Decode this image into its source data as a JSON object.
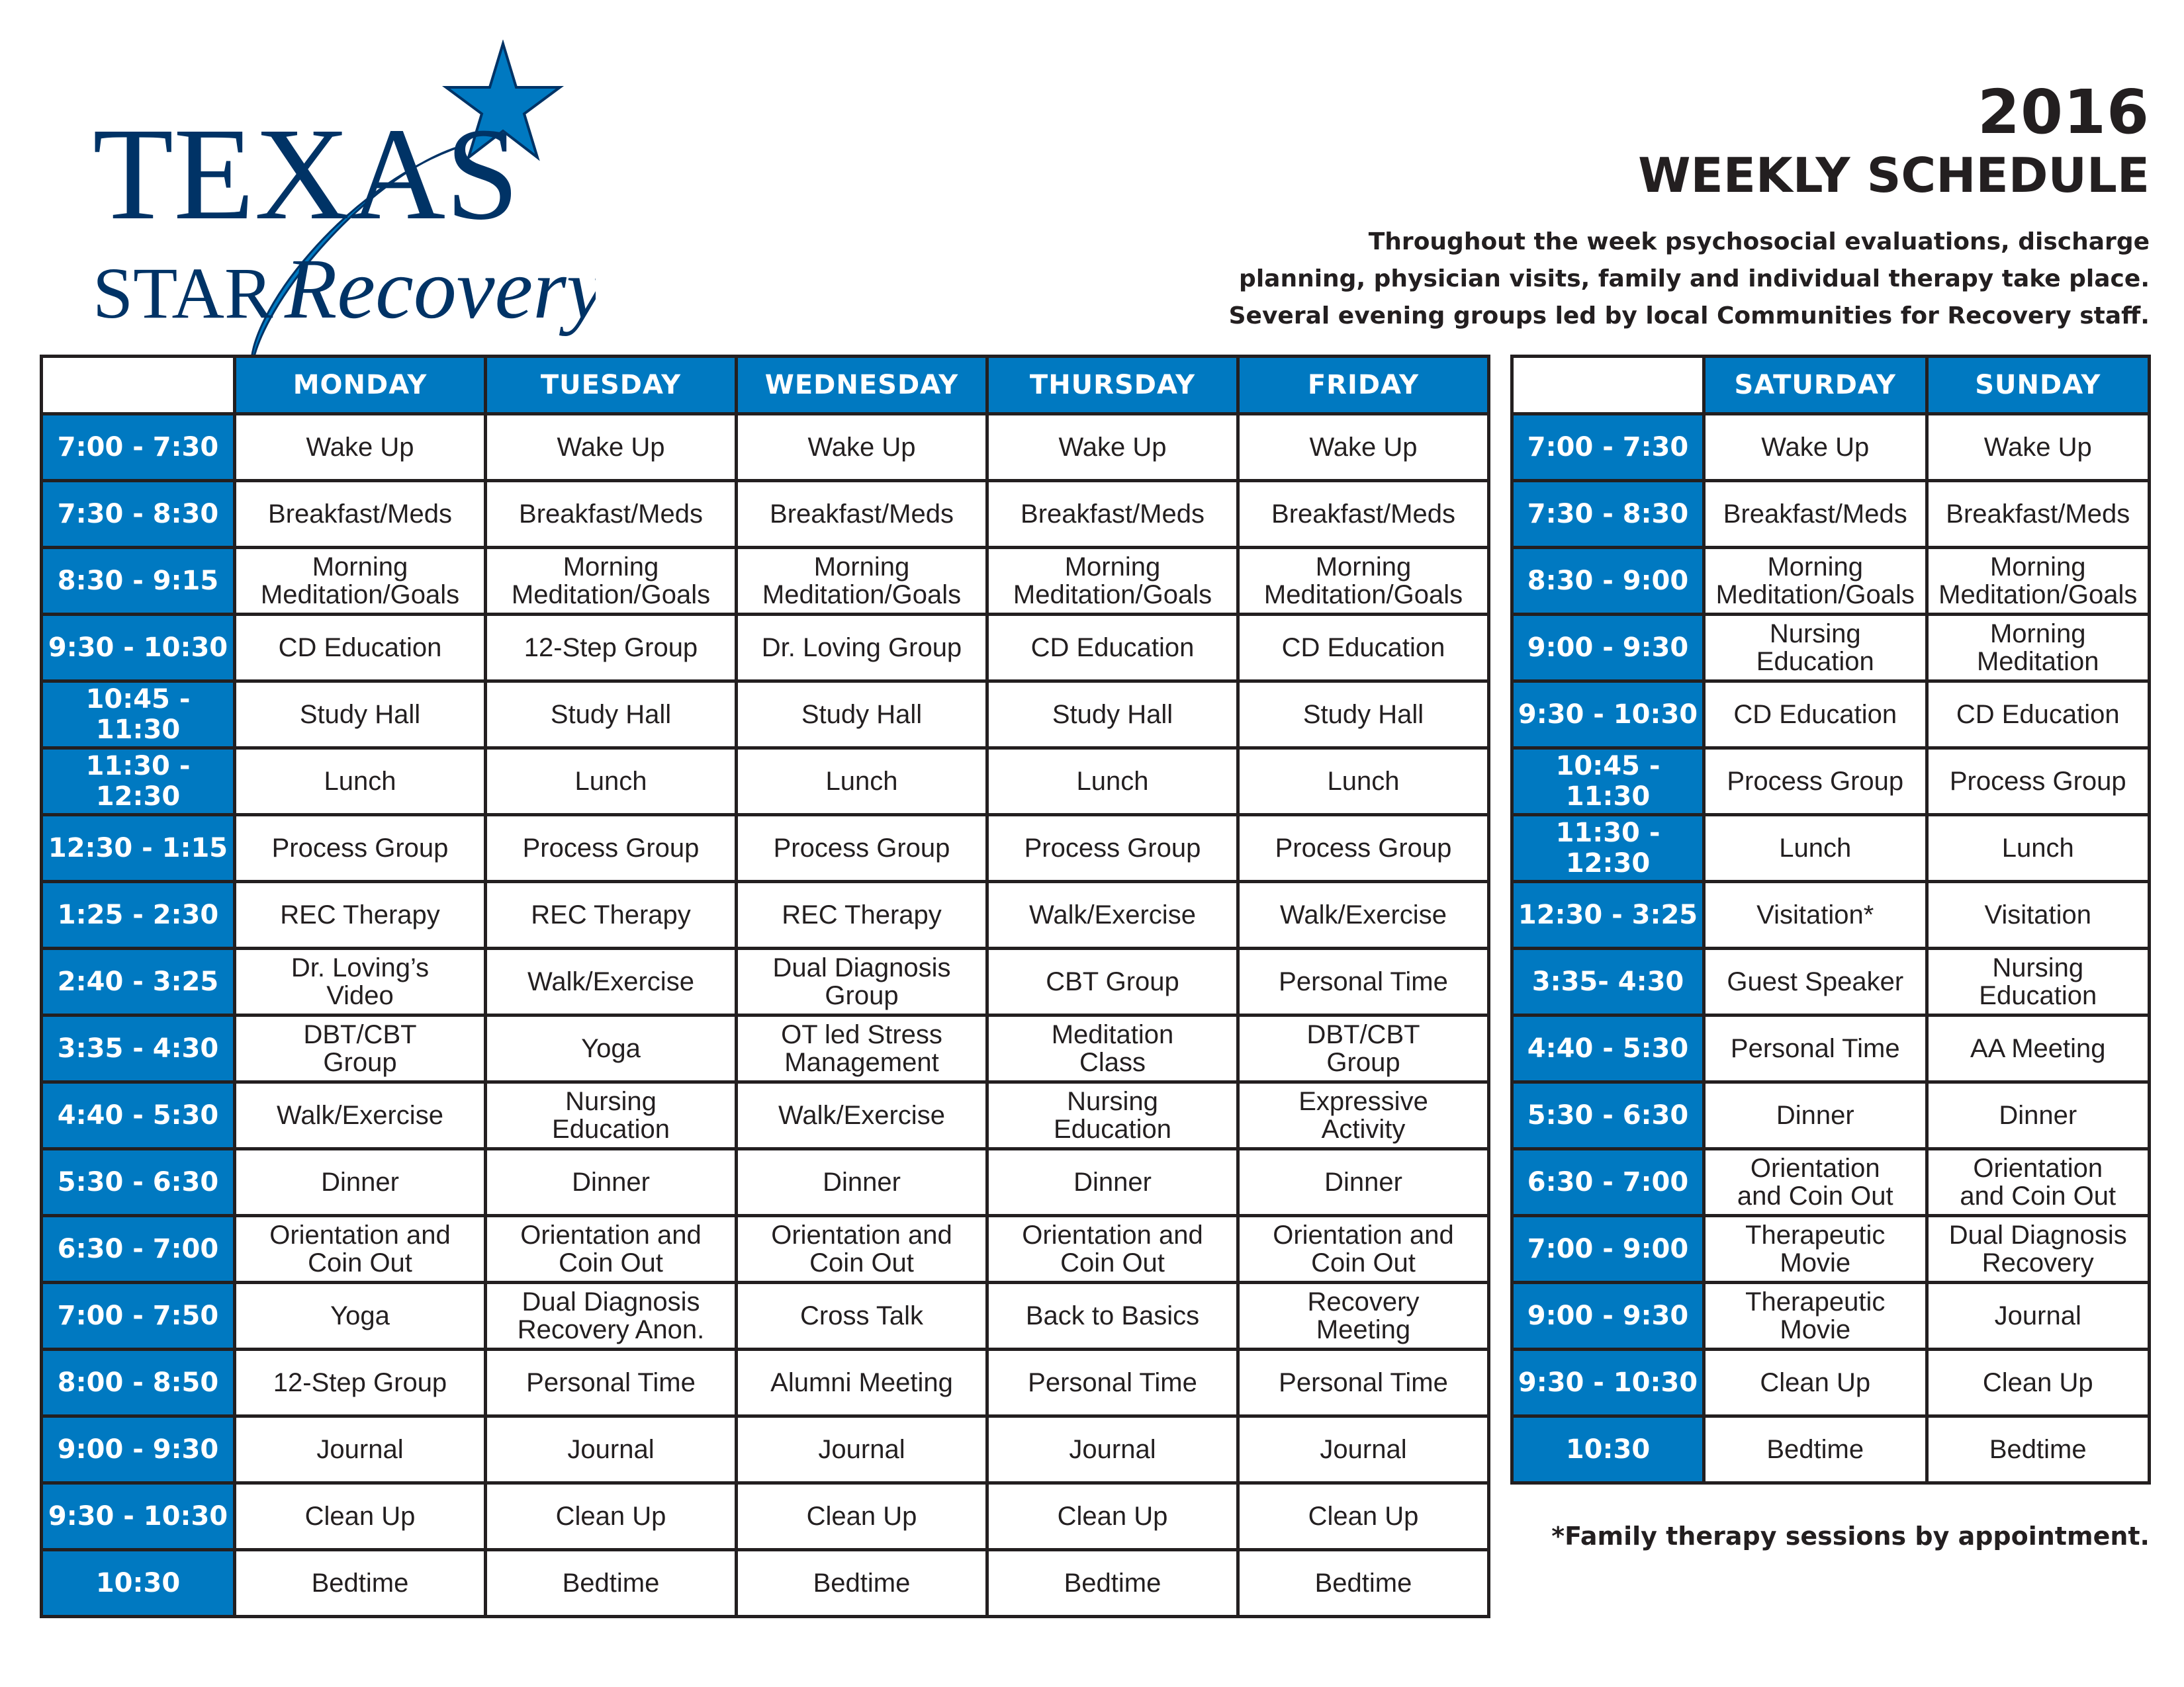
{
  "brand": {
    "logo_line1": "TEXAS",
    "logo_line2_a": "STAR",
    "logo_line2_b": "Recovery",
    "navy": "#003366",
    "accent_blue": "#0079c1"
  },
  "header": {
    "year": "2016",
    "title": "WEEKLY SCHEDULE",
    "description_lines": [
      "Throughout the week psychosocial evaluations, discharge",
      "planning, physician visits, family and individual therapy take place.",
      "Several evening groups led by local Communities for Recovery staff."
    ]
  },
  "weekday_table": {
    "days": [
      "MONDAY",
      "TUESDAY",
      "WEDNESDAY",
      "THURSDAY",
      "FRIDAY"
    ],
    "rows": [
      {
        "time": "7:00 - 7:30",
        "cells": [
          "Wake Up",
          "Wake Up",
          "Wake Up",
          "Wake Up",
          "Wake Up"
        ]
      },
      {
        "time": "7:30 - 8:30",
        "cells": [
          "Breakfast/Meds",
          "Breakfast/Meds",
          "Breakfast/Meds",
          "Breakfast/Meds",
          "Breakfast/Meds"
        ]
      },
      {
        "time": "8:30 - 9:15",
        "cells": [
          "Morning\nMeditation/Goals",
          "Morning\nMeditation/Goals",
          "Morning\nMeditation/Goals",
          "Morning\nMeditation/Goals",
          "Morning\nMeditation/Goals"
        ]
      },
      {
        "time": "9:30 - 10:30",
        "cells": [
          "CD Education",
          "12-Step Group",
          "Dr. Loving Group",
          "CD Education",
          "CD Education"
        ]
      },
      {
        "time": "10:45 - 11:30",
        "cells": [
          "Study Hall",
          "Study Hall",
          "Study Hall",
          "Study Hall",
          "Study Hall"
        ]
      },
      {
        "time": "11:30 - 12:30",
        "cells": [
          "Lunch",
          "Lunch",
          "Lunch",
          "Lunch",
          "Lunch"
        ]
      },
      {
        "time": "12:30 - 1:15",
        "cells": [
          "Process Group",
          "Process Group",
          "Process Group",
          "Process Group",
          "Process Group"
        ]
      },
      {
        "time": "1:25 - 2:30",
        "cells": [
          "REC Therapy",
          "REC Therapy",
          "REC Therapy",
          "Walk/Exercise",
          "Walk/Exercise"
        ]
      },
      {
        "time": "2:40 - 3:25",
        "cells": [
          "Dr. Loving’s\nVideo",
          "Walk/Exercise",
          "Dual Diagnosis\nGroup",
          "CBT Group",
          "Personal Time"
        ]
      },
      {
        "time": "3:35 - 4:30",
        "cells": [
          "DBT/CBT\nGroup",
          "Yoga",
          "OT led Stress\nManagement",
          "Meditation\nClass",
          "DBT/CBT\nGroup"
        ]
      },
      {
        "time": "4:40 - 5:30",
        "cells": [
          "Walk/Exercise",
          "Nursing\nEducation",
          "Walk/Exercise",
          "Nursing\nEducation",
          "Expressive\nActivity"
        ]
      },
      {
        "time": "5:30 - 6:30",
        "cells": [
          "Dinner",
          "Dinner",
          "Dinner",
          "Dinner",
          "Dinner"
        ]
      },
      {
        "time": "6:30 - 7:00",
        "cells": [
          "Orientation and\nCoin Out",
          "Orientation and\nCoin Out",
          "Orientation and\nCoin Out",
          "Orientation and\nCoin Out",
          "Orientation and\nCoin Out"
        ]
      },
      {
        "time": "7:00 - 7:50",
        "cells": [
          "Yoga",
          "Dual Diagnosis\nRecovery Anon.",
          "Cross Talk",
          "Back to Basics",
          "Recovery\nMeeting"
        ]
      },
      {
        "time": "8:00 - 8:50",
        "cells": [
          "12-Step Group",
          "Personal Time",
          "Alumni Meeting",
          "Personal Time",
          "Personal Time"
        ]
      },
      {
        "time": "9:00 - 9:30",
        "cells": [
          "Journal",
          "Journal",
          "Journal",
          "Journal",
          "Journal"
        ]
      },
      {
        "time": "9:30 - 10:30",
        "cells": [
          "Clean Up",
          "Clean Up",
          "Clean Up",
          "Clean Up",
          "Clean Up"
        ]
      },
      {
        "time": "10:30",
        "cells": [
          "Bedtime",
          "Bedtime",
          "Bedtime",
          "Bedtime",
          "Bedtime"
        ]
      }
    ]
  },
  "weekend_table": {
    "days": [
      "SATURDAY",
      "SUNDAY"
    ],
    "rows": [
      {
        "time": "7:00 - 7:30",
        "cells": [
          "Wake Up",
          "Wake Up"
        ]
      },
      {
        "time": "7:30 - 8:30",
        "cells": [
          "Breakfast/Meds",
          "Breakfast/Meds"
        ]
      },
      {
        "time": "8:30 - 9:00",
        "cells": [
          "Morning\nMeditation/Goals",
          "Morning\nMeditation/Goals"
        ]
      },
      {
        "time": "9:00 - 9:30",
        "cells": [
          "Nursing\nEducation",
          "Morning\nMeditation"
        ]
      },
      {
        "time": "9:30 - 10:30",
        "cells": [
          "CD Education",
          "CD Education"
        ]
      },
      {
        "time": "10:45 - 11:30",
        "cells": [
          "Process Group",
          "Process Group"
        ]
      },
      {
        "time": "11:30 - 12:30",
        "cells": [
          "Lunch",
          "Lunch"
        ]
      },
      {
        "time": "12:30 - 3:25",
        "cells": [
          "Visitation*",
          "Visitation"
        ]
      },
      {
        "time": "3:35- 4:30",
        "cells": [
          "Guest Speaker",
          "Nursing\nEducation"
        ]
      },
      {
        "time": "4:40 - 5:30",
        "cells": [
          "Personal Time",
          "AA Meeting"
        ]
      },
      {
        "time": "5:30 - 6:30",
        "cells": [
          "Dinner",
          "Dinner"
        ]
      },
      {
        "time": "6:30 - 7:00",
        "cells": [
          "Orientation\nand Coin Out",
          "Orientation\nand Coin Out"
        ]
      },
      {
        "time": "7:00 - 9:00",
        "cells": [
          "Therapeutic\nMovie",
          "Dual Diagnosis\nRecovery"
        ]
      },
      {
        "time": "9:00 - 9:30",
        "cells": [
          "Therapeutic\nMovie",
          "Journal"
        ]
      },
      {
        "time": "9:30 - 10:30",
        "cells": [
          "Clean Up",
          "Clean Up"
        ]
      },
      {
        "time": "10:30",
        "cells": [
          "Bedtime",
          "Bedtime"
        ]
      }
    ],
    "footnote": "*Family therapy sessions by appointment."
  }
}
